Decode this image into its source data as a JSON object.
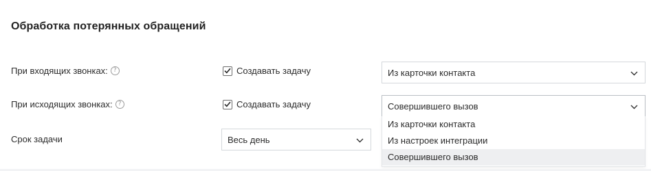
{
  "section": {
    "title": "Обработка потерянных обращений"
  },
  "incoming": {
    "label": "При входящих звонках:",
    "help_icon": "question-circle-icon",
    "checkbox_label": "Создавать задачу",
    "checkbox_checked": true,
    "select_value": "Из карточки контакта"
  },
  "outgoing": {
    "label": "При исходящих звонках:",
    "help_icon": "question-circle-icon",
    "checkbox_label": "Создавать задачу",
    "checkbox_checked": true,
    "select_value": "Совершившего вызов",
    "options": [
      "Из карточки контакта",
      "Из настроек интеграции",
      "Совершившего вызов"
    ],
    "selected_option_index": 2
  },
  "deadline": {
    "label": "Срок задачи",
    "select_value": "Весь день"
  },
  "colors": {
    "text": "#2b2b2b",
    "border": "#d4d7db",
    "option_hover": "#eeeff1"
  }
}
